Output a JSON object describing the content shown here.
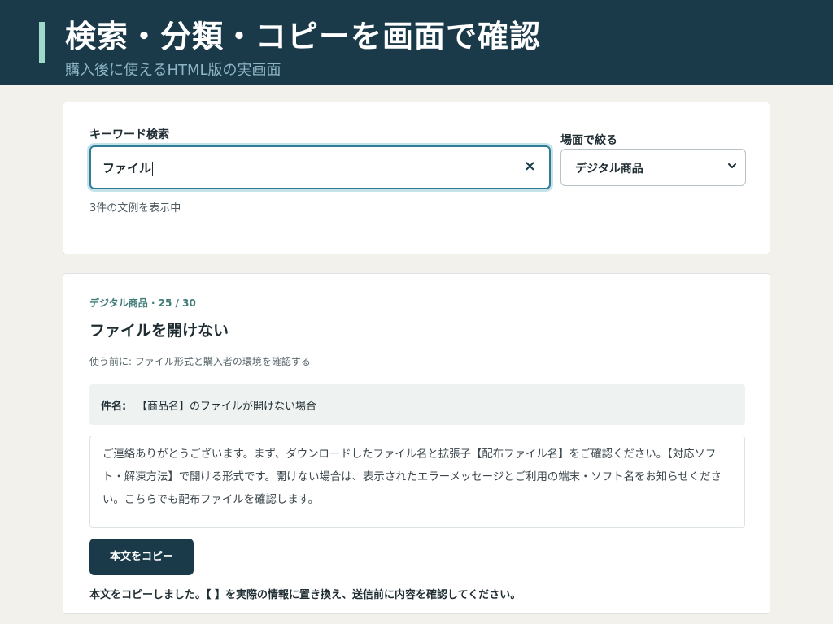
{
  "header": {
    "title": "検索・分類・コピーを画面で確認",
    "subtitle": "購入後に使えるHTML版の実画面"
  },
  "search": {
    "keyword_label": "キーワード検索",
    "keyword_value": "ファイル",
    "clear_glyph": "×",
    "scene_label": "場面で絞る",
    "scene_selected": "デジタル商品",
    "result_count": "3件の文例を表示中"
  },
  "result": {
    "meta": "デジタル商品 · 25 / 30",
    "title": "ファイルを開けない",
    "pre_check": "使う前に: ファイル形式と購入者の環境を確認する",
    "subject_label": "件名:",
    "subject_text": "【商品名】のファイルが開けない場合",
    "body": "ご連絡ありがとうございます。まず、ダウンロードしたファイル名と拡張子【配布ファイル名】をご確認ください。【対応ソフト・解凍方法】で開ける形式です。開けない場合は、表示されたエラーメッセージとご利用の端末・ソフト名をお知らせください。こちらでも配布ファイルを確認します。",
    "copy_button": "本文をコピー",
    "copied_message": "本文をコピーしました。【 】を実際の情報に置き換え、送信前に内容を確認してください。"
  },
  "colors": {
    "header_bg": "#1a3a4a",
    "accent": "#9ed9c9",
    "focus": "#2f7d96",
    "meta": "#3f7b77",
    "page_bg": "#f3f1ec"
  },
  "icons": {
    "clear": "close-icon",
    "select": "chevron-down-icon"
  }
}
